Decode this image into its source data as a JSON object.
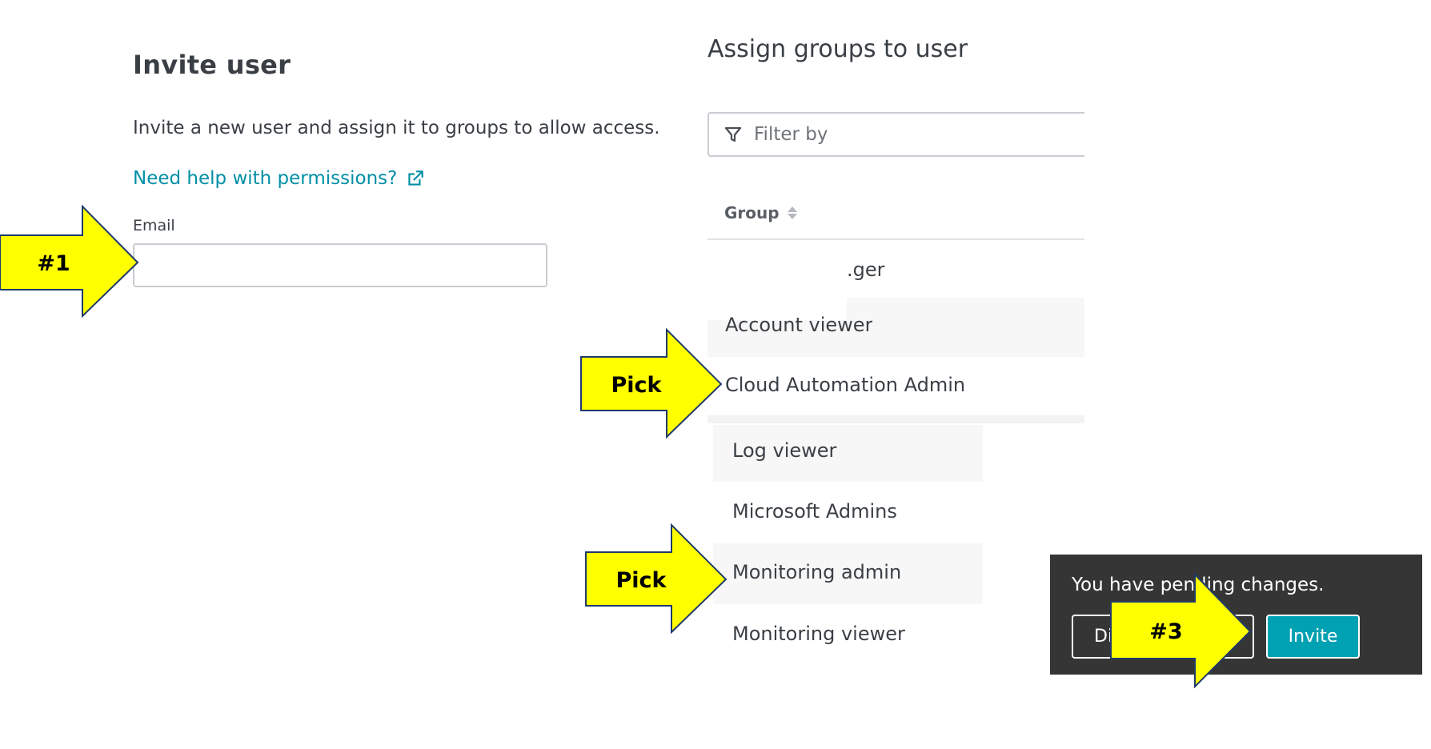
{
  "left_panel": {
    "title": "Invite user",
    "description": "Invite a new user and assign it to groups to allow access.",
    "help_link": "Need help with permissions?",
    "email_label": "Email",
    "email_value": ""
  },
  "right_panel": {
    "title": "Assign groups to user",
    "filter_placeholder": "Filter by",
    "column_header": "Group",
    "groups": [
      {
        "label": ".ger"
      },
      {
        "label": "Account viewer"
      },
      {
        "label": "Cloud Automation Admin"
      },
      {
        "label": "Log viewer"
      },
      {
        "label": "Microsoft Admins"
      },
      {
        "label": "Monitoring admin"
      },
      {
        "label": "Monitoring viewer"
      }
    ]
  },
  "pending_bar": {
    "message": "You have pending changes.",
    "discard_label": "Discard",
    "invite_label": "Invite"
  },
  "callouts": {
    "email": "#1",
    "pick_first": "Pick",
    "pick_second": "Pick",
    "invite": "#3",
    "arrow_fill": "#ffff00",
    "arrow_stroke": "#1f3a6b"
  },
  "colors": {
    "link": "#008fa6",
    "primary_button": "#00a1b2",
    "pending_bar_bg": "#353535"
  },
  "icons": {
    "help_link": "external-link-icon",
    "filter": "filter-icon",
    "sort": "sort-icon"
  }
}
